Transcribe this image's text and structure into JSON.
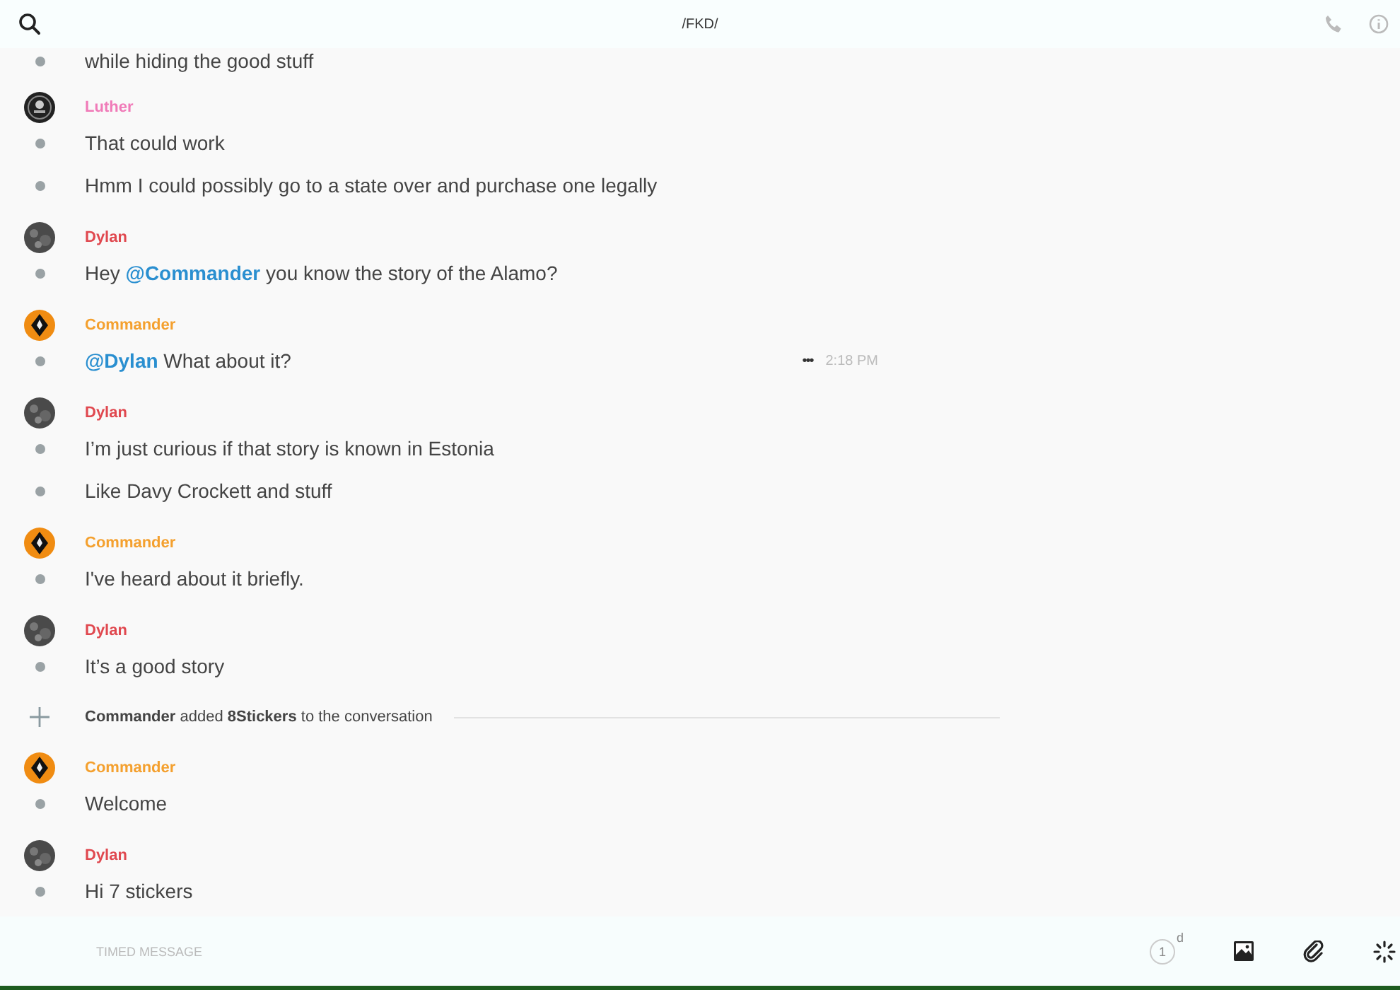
{
  "header": {
    "title": "/FKD/"
  },
  "feed": [
    {
      "kind": "message",
      "lines": [
        {
          "parts": [
            {
              "text": "while hiding the good stuff"
            }
          ]
        }
      ]
    },
    {
      "kind": "message",
      "author": "Luther",
      "color": "#f07ab8",
      "avatar": {
        "kind": "emblem"
      },
      "lines": [
        {
          "parts": [
            {
              "text": "That could work"
            }
          ]
        },
        {
          "parts": [
            {
              "text": "Hmm I could possibly go to a state over and purchase one legally"
            }
          ]
        }
      ]
    },
    {
      "kind": "message",
      "author": "Dylan",
      "color": "#e0484f",
      "avatar": {
        "kind": "photo"
      },
      "lines": [
        {
          "parts": [
            {
              "text": "Hey "
            },
            {
              "text": "@Commander",
              "kind": "mention"
            },
            {
              "text": " you know the story of the Alamo?"
            }
          ]
        }
      ]
    },
    {
      "kind": "message",
      "author": "Commander",
      "color": "#f4a02e",
      "avatar": {
        "kind": "diamond"
      },
      "lines": [
        {
          "parts": [
            {
              "text": "@Dylan",
              "kind": "mention"
            },
            {
              "text": " What about it?"
            }
          ],
          "more": "•••",
          "time": "2:18 PM"
        }
      ]
    },
    {
      "kind": "message",
      "author": "Dylan",
      "color": "#e0484f",
      "avatar": {
        "kind": "photo"
      },
      "lines": [
        {
          "parts": [
            {
              "text": "I’m just curious if that story is known in Estonia"
            }
          ]
        },
        {
          "parts": [
            {
              "text": "Like Davy Crockett and stuff"
            }
          ]
        }
      ]
    },
    {
      "kind": "message",
      "author": "Commander",
      "color": "#f4a02e",
      "avatar": {
        "kind": "diamond"
      },
      "lines": [
        {
          "parts": [
            {
              "text": "I've heard about it briefly."
            }
          ]
        }
      ]
    },
    {
      "kind": "message",
      "author": "Dylan",
      "color": "#e0484f",
      "avatar": {
        "kind": "photo"
      },
      "lines": [
        {
          "parts": [
            {
              "text": "It’s a good story"
            }
          ]
        }
      ]
    },
    {
      "kind": "event",
      "text": "**Commander** added **8Stickers** to the conversation"
    },
    {
      "kind": "message",
      "author": "Commander",
      "color": "#f4a02e",
      "avatar": {
        "kind": "diamond"
      },
      "lines": [
        {
          "parts": [
            {
              "text": "Welcome"
            }
          ]
        }
      ]
    },
    {
      "kind": "message",
      "author": "Dylan",
      "color": "#e0484f",
      "avatar": {
        "kind": "photo"
      },
      "lines": [
        {
          "parts": [
            {
              "text": "Hi 7 stickers"
            }
          ]
        }
      ]
    }
  ],
  "composer": {
    "placeholder": "TIMED MESSAGE",
    "timer": {
      "value": "1",
      "unit": "d"
    }
  }
}
